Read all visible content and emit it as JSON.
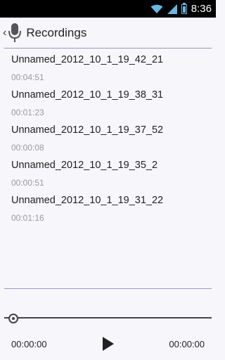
{
  "status_bar": {
    "time": "8:36",
    "icons": [
      "wifi-icon",
      "signal-icon",
      "battery-icon"
    ]
  },
  "action_bar": {
    "title": "Recordings",
    "icon": "microphone-icon"
  },
  "recordings": [
    {
      "name": "Unnamed_2012_10_1_19_42_21",
      "duration": "00:04:51"
    },
    {
      "name": "Unnamed_2012_10_1_19_38_31",
      "duration": "00:01:23"
    },
    {
      "name": "Unnamed_2012_10_1_19_37_52",
      "duration": "00:00:08"
    },
    {
      "name": "Unnamed_2012_10_1_19_35_2",
      "duration": "00:00:51"
    },
    {
      "name": "Unnamed_2012_10_1_19_31_22",
      "duration": "00:01:16"
    }
  ],
  "player": {
    "current_time": "00:00:00",
    "total_time": "00:00:00",
    "progress": 0
  },
  "colors": {
    "divider": "#9a95c8",
    "battery": "#6ab7e6",
    "background": "#f7f6fb"
  }
}
